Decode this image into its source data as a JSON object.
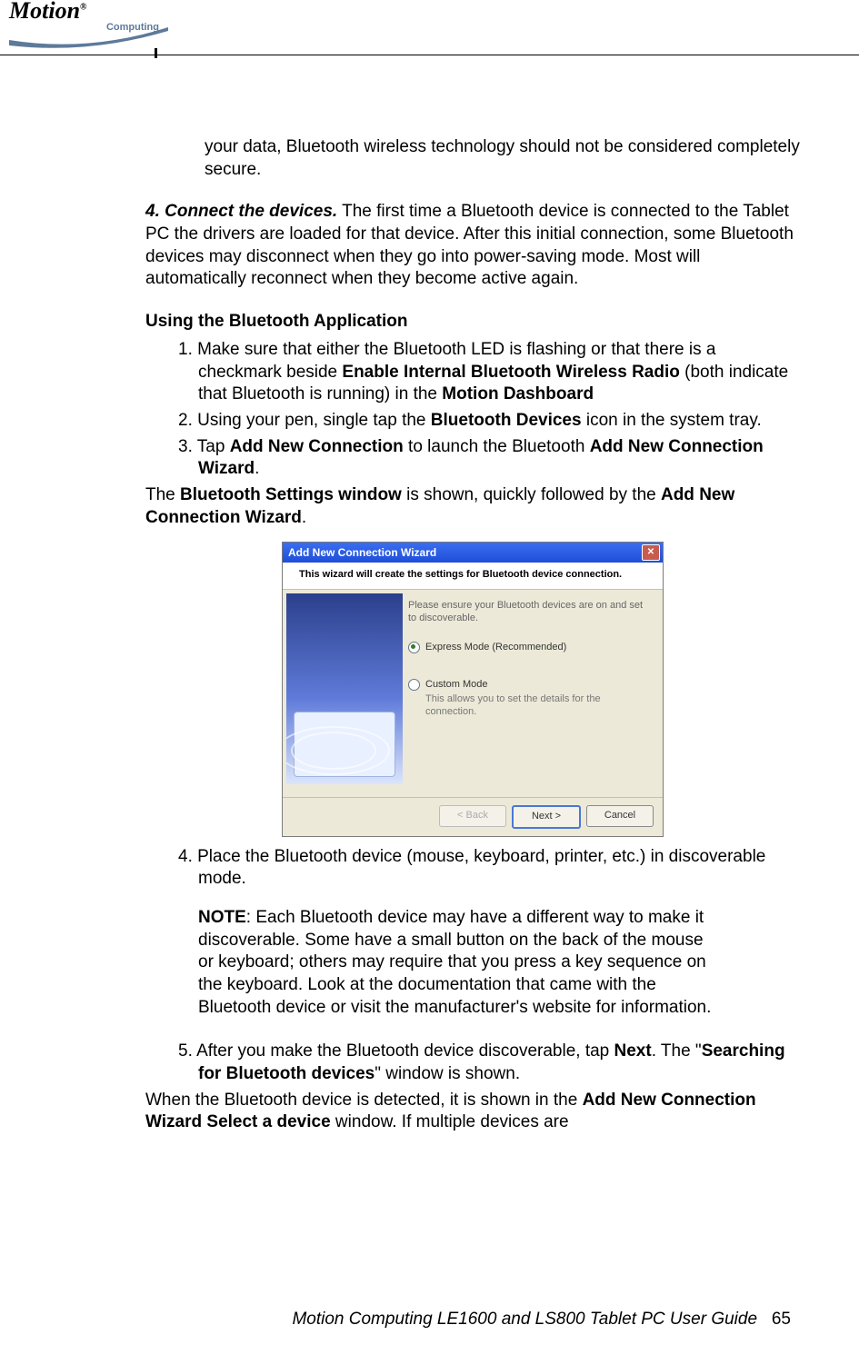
{
  "logo": {
    "brand": "Motion",
    "sub": "Computing",
    "reg": "®"
  },
  "p1": "your data, Bluetooth wireless technology should not be considered completely secure.",
  "p2": {
    "lead_bi": "4. Connect the devices.",
    "rest": " The first time a Bluetooth device is connected to the Tablet PC the drivers are loaded for that device. After this initial connection, some Bluetooth devices may disconnect when they go into power-saving mode. Most will automatically reconnect when they become active again."
  },
  "section_title": "Using the Bluetooth Application",
  "steps": {
    "s1": {
      "num": "1. ",
      "a": "Make sure that either the Bluetooth LED is flashing or that there is a checkmark beside ",
      "b1": "Enable Internal Bluetooth Wireless Radio",
      "c": " (both indicate that Bluetooth is running) in the ",
      "b2": "Motion Dashboard"
    },
    "s2": {
      "num": "2. ",
      "a": "Using your pen, single tap the ",
      "b1": "Bluetooth Devices",
      "c": " icon in the system tray."
    },
    "s3": {
      "num": "3. ",
      "a": "Tap ",
      "b1": "Add New Connection",
      "c": " to launch the Bluetooth ",
      "b2": "Add New Connection Wizard",
      "d": "."
    }
  },
  "aftersteps": {
    "a": "The ",
    "b1": "Bluetooth Settings window",
    "c": " is shown, quickly followed by the ",
    "b2": "Add New Connection Wizard",
    "d": "."
  },
  "wizard": {
    "title": "Add New Connection Wizard",
    "subtitle": "This wizard will create the settings for Bluetooth device connection.",
    "note": "Please ensure your Bluetooth devices are on and set to discoverable.",
    "option1": "Express Mode (Recommended)",
    "option2": "Custom Mode",
    "option2_sub": "This allows you to set the details for the connection.",
    "back": "< Back",
    "next": "Next >",
    "cancel": "Cancel"
  },
  "steps2": {
    "s4": {
      "num": "4. ",
      "a": "Place the Bluetooth device (mouse, keyboard, printer, etc.) in discoverable mode."
    },
    "note": {
      "lead": "NOTE",
      "rest": ": Each Bluetooth device may have a different way to make it discoverable. Some have a small button on the back of the mouse or keyboard; others may require that you press a key sequence on the keyboard. Look at the documentation that came with the Bluetooth device or visit the manufacturer's website for information."
    },
    "s5": {
      "num": "5. ",
      "a": "After you make the Bluetooth device discoverable, tap ",
      "b1": "Next",
      "c": ". The \"",
      "b2": "Searching for Bluetooth devices",
      "d": "\" window is shown."
    }
  },
  "after2": {
    "a": "When the Bluetooth device is detected, it is shown in the ",
    "b1": "Add New Connection Wizard Select a device",
    "c": " window. If multiple devices are"
  },
  "footer": {
    "text": "Motion Computing LE1600 and LS800 Tablet PC User Guide",
    "page": "65"
  }
}
